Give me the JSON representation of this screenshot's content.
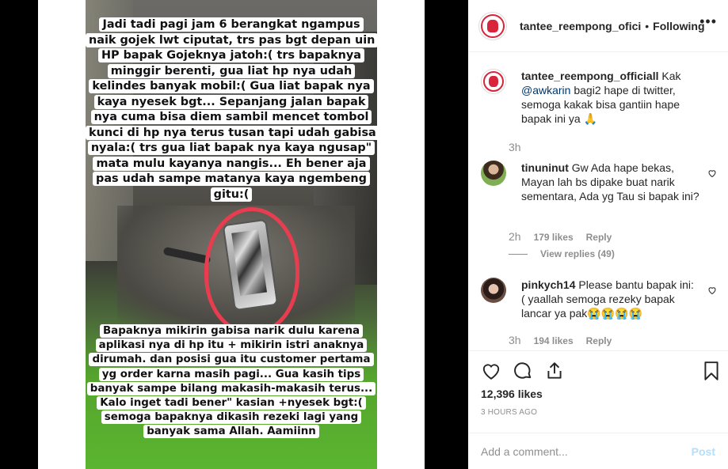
{
  "story": {
    "caption_top": "Jadi tadi pagi jam 6 berangkat ngampus naik gojek lwt ciputat, trs pas bgt depan uin HP bapak Gojeknya jatoh:( trs bapaknya minggir berenti, gua liat hp nya udah kelindes banyak mobil:( Gua liat bapak nya kaya nyesek bgt... Sepanjang jalan bapak nya cuma bisa diem sambil mencet tombol kunci di hp nya terus tusan tapi udah gabisa nyala:( trs gua liat bapak nya kaya ngusap\" mata mulu kayanya nangis... Eh bener aja pas udah sampe matanya kaya ngembeng gitu:(",
    "caption_bottom": "Bapaknya mikirin gabisa narik dulu karena aplikasi nya di hp itu + mikirin istri anaknya dirumah. dan posisi gua itu customer pertama yg order karna masih pagi... Gua kasih tips banyak sampe bilang makasih-makasih terus... Kalo inget tadi bener\" kasian +nyesek bgt:( semoga bapaknya dikasih rezeki lagi yang banyak sama Allah. Aamiinn"
  },
  "header": {
    "username": "tantee_reempong_ofici",
    "separator": "•",
    "follow_status": "Following",
    "more_icon": "ellipsis-icon"
  },
  "caption_comment": {
    "username": "tantee_reempong_officiall",
    "text_before": "Kak",
    "mention": "@awkarin",
    "text_after": "bagi2 hape di twitter, semoga kakak bisa gantiin hape bapak ini ya 🙏",
    "time": "3h"
  },
  "comments": [
    {
      "username": "tinuninut",
      "text": "Gw Ada hape bekas, Mayan lah bs dipake buat narik sementara, Ada yg Tau si bapak ini?",
      "time": "2h",
      "likes": "179 likes",
      "reply": "Reply",
      "view_replies": "View replies (49)"
    },
    {
      "username": "pinkych14",
      "text": "Please bantu bapak ini: ( yaallah semoga rezeky bapak lancar ya pak😭😭😭😭",
      "time": "3h",
      "likes": "194 likes",
      "reply": "Reply"
    }
  ],
  "actions": {
    "likes": "12,396 likes",
    "time_ago": "3 HOURS AGO",
    "icons": [
      "heart-icon",
      "comment-icon",
      "share-icon",
      "bookmark-icon"
    ]
  },
  "add_comment": {
    "placeholder": "Add a comment...",
    "post_label": "Post"
  },
  "colors": {
    "link": "#00376b",
    "muted": "#8e8e8e",
    "post_disabled": "#b2dffc",
    "circle": "#e83c4f"
  }
}
